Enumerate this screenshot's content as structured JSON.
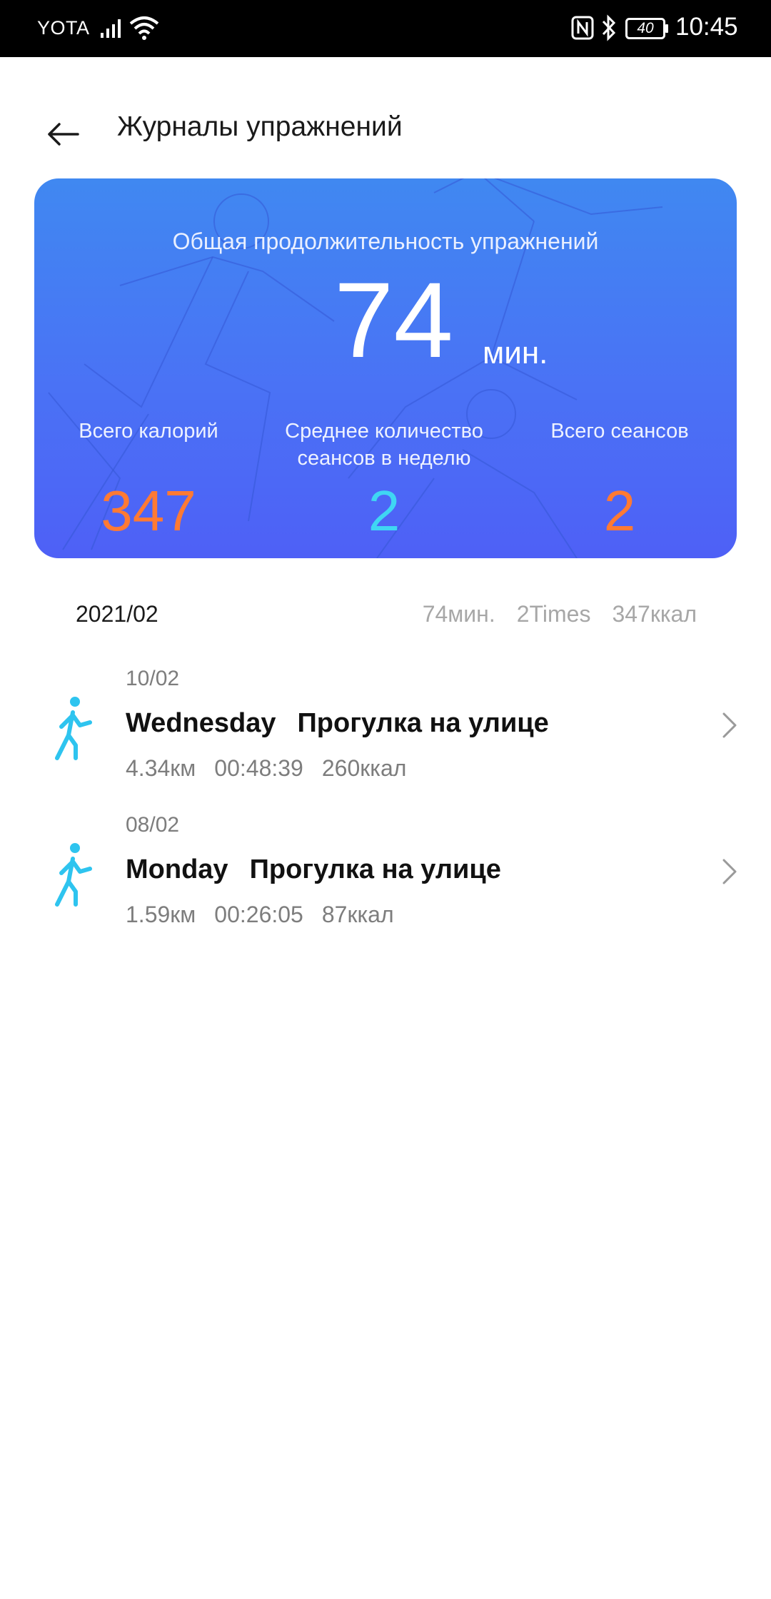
{
  "status_bar": {
    "carrier": "YOTA",
    "battery": "40",
    "time": "10:45"
  },
  "header": {
    "title": "Журналы упражнений"
  },
  "summary": {
    "heading": "Общая продолжительность упражнений",
    "total_duration": "74",
    "duration_unit": "мин.",
    "stats": [
      {
        "label": "Всего калорий",
        "value": "347"
      },
      {
        "label": "Среднее количество сеансов в неделю",
        "value": "2"
      },
      {
        "label": "Всего сеансов",
        "value": "2"
      }
    ]
  },
  "month": {
    "label": "2021/02",
    "duration": "74мин.",
    "times": "2Times",
    "calories": "347ккал"
  },
  "workouts": [
    {
      "date": "10/02",
      "day": "Wednesday",
      "type": "Прогулка на улице",
      "distance": "4.34км",
      "duration": "00:48:39",
      "calories": "260ккал"
    },
    {
      "date": "08/02",
      "day": "Monday",
      "type": "Прогулка на улице",
      "distance": "1.59км",
      "duration": "00:26:05",
      "calories": "87ккал"
    }
  ],
  "colors": {
    "card_top": "#4088f1",
    "card_bottom": "#4e60f6",
    "accent_orange": "#ff7a33",
    "accent_cyan": "#3fd6f3",
    "walk_icon": "#2ec4ef"
  }
}
